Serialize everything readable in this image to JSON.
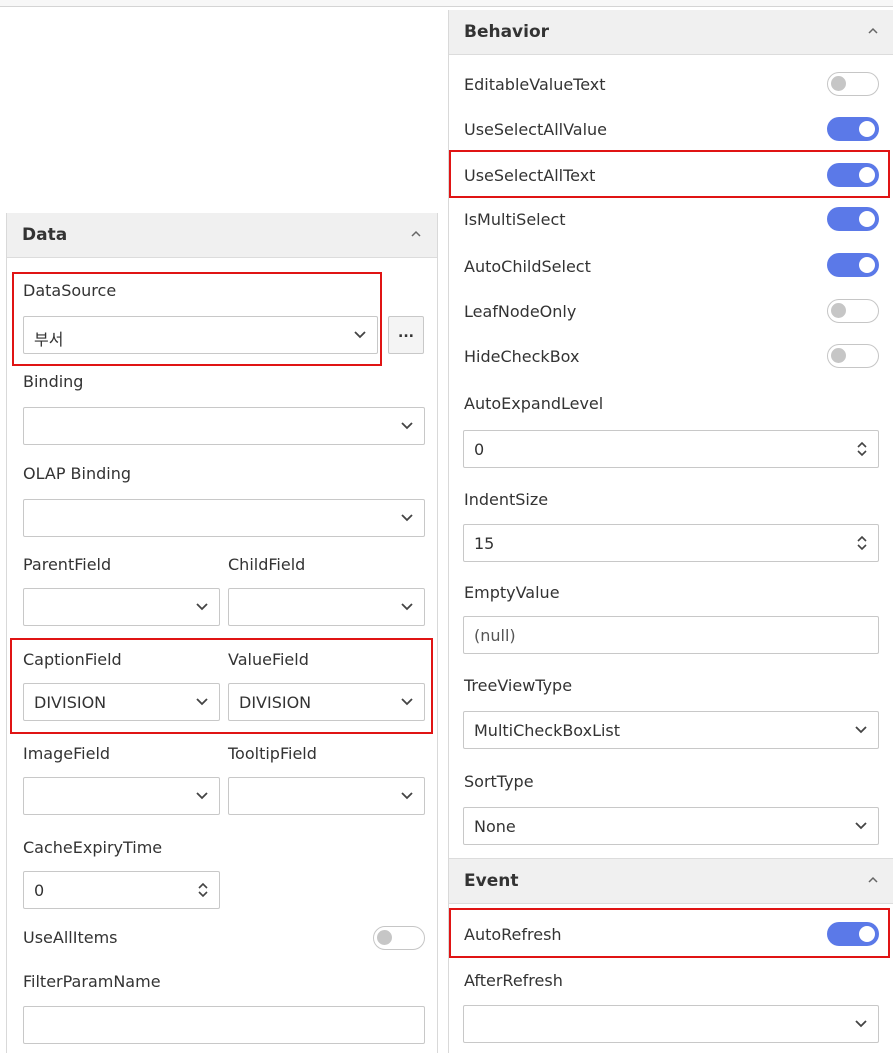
{
  "data_panel": {
    "title": "Data",
    "datasource": {
      "label": "DataSource",
      "value": "부서",
      "more_label": "..."
    },
    "binding": {
      "label": "Binding",
      "value": ""
    },
    "olap_binding": {
      "label": "OLAP Binding",
      "value": ""
    },
    "parent_field": {
      "label": "ParentField",
      "value": ""
    },
    "child_field": {
      "label": "ChildField",
      "value": ""
    },
    "caption_field": {
      "label": "CaptionField",
      "value": "DIVISION"
    },
    "value_field": {
      "label": "ValueField",
      "value": "DIVISION"
    },
    "image_field": {
      "label": "ImageField",
      "value": ""
    },
    "tooltip_field": {
      "label": "TooltipField",
      "value": ""
    },
    "cache_expiry_time": {
      "label": "CacheExpiryTime",
      "value": "0"
    },
    "use_all_items": {
      "label": "UseAllItems",
      "on": false
    },
    "filter_param_name": {
      "label": "FilterParamName",
      "value": ""
    }
  },
  "behavior_panel": {
    "title": "Behavior",
    "toggles": [
      {
        "label": "EditableValueText",
        "on": false
      },
      {
        "label": "UseSelectAllValue",
        "on": true
      },
      {
        "label": "UseSelectAllText",
        "on": true
      },
      {
        "label": "IsMultiSelect",
        "on": true
      },
      {
        "label": "AutoChildSelect",
        "on": true
      },
      {
        "label": "LeafNodeOnly",
        "on": false
      },
      {
        "label": "HideCheckBox",
        "on": false
      }
    ],
    "auto_expand_level": {
      "label": "AutoExpandLevel",
      "value": "0"
    },
    "indent_size": {
      "label": "IndentSize",
      "value": "15"
    },
    "empty_value": {
      "label": "EmptyValue",
      "value": "(null)"
    },
    "tree_view_type": {
      "label": "TreeViewType",
      "value": "MultiCheckBoxList"
    },
    "sort_type": {
      "label": "SortType",
      "value": "None"
    }
  },
  "event_panel": {
    "title": "Event",
    "auto_refresh": {
      "label": "AutoRefresh",
      "on": true
    },
    "after_refresh": {
      "label": "AfterRefresh",
      "value": ""
    }
  },
  "colors": {
    "accent": "#5b79e8",
    "highlight": "#e01414",
    "header_bg": "#f0f0f0"
  },
  "icons": [
    "chevron-up-icon",
    "chevron-down-icon",
    "spinner-icon",
    "more-icon"
  ]
}
